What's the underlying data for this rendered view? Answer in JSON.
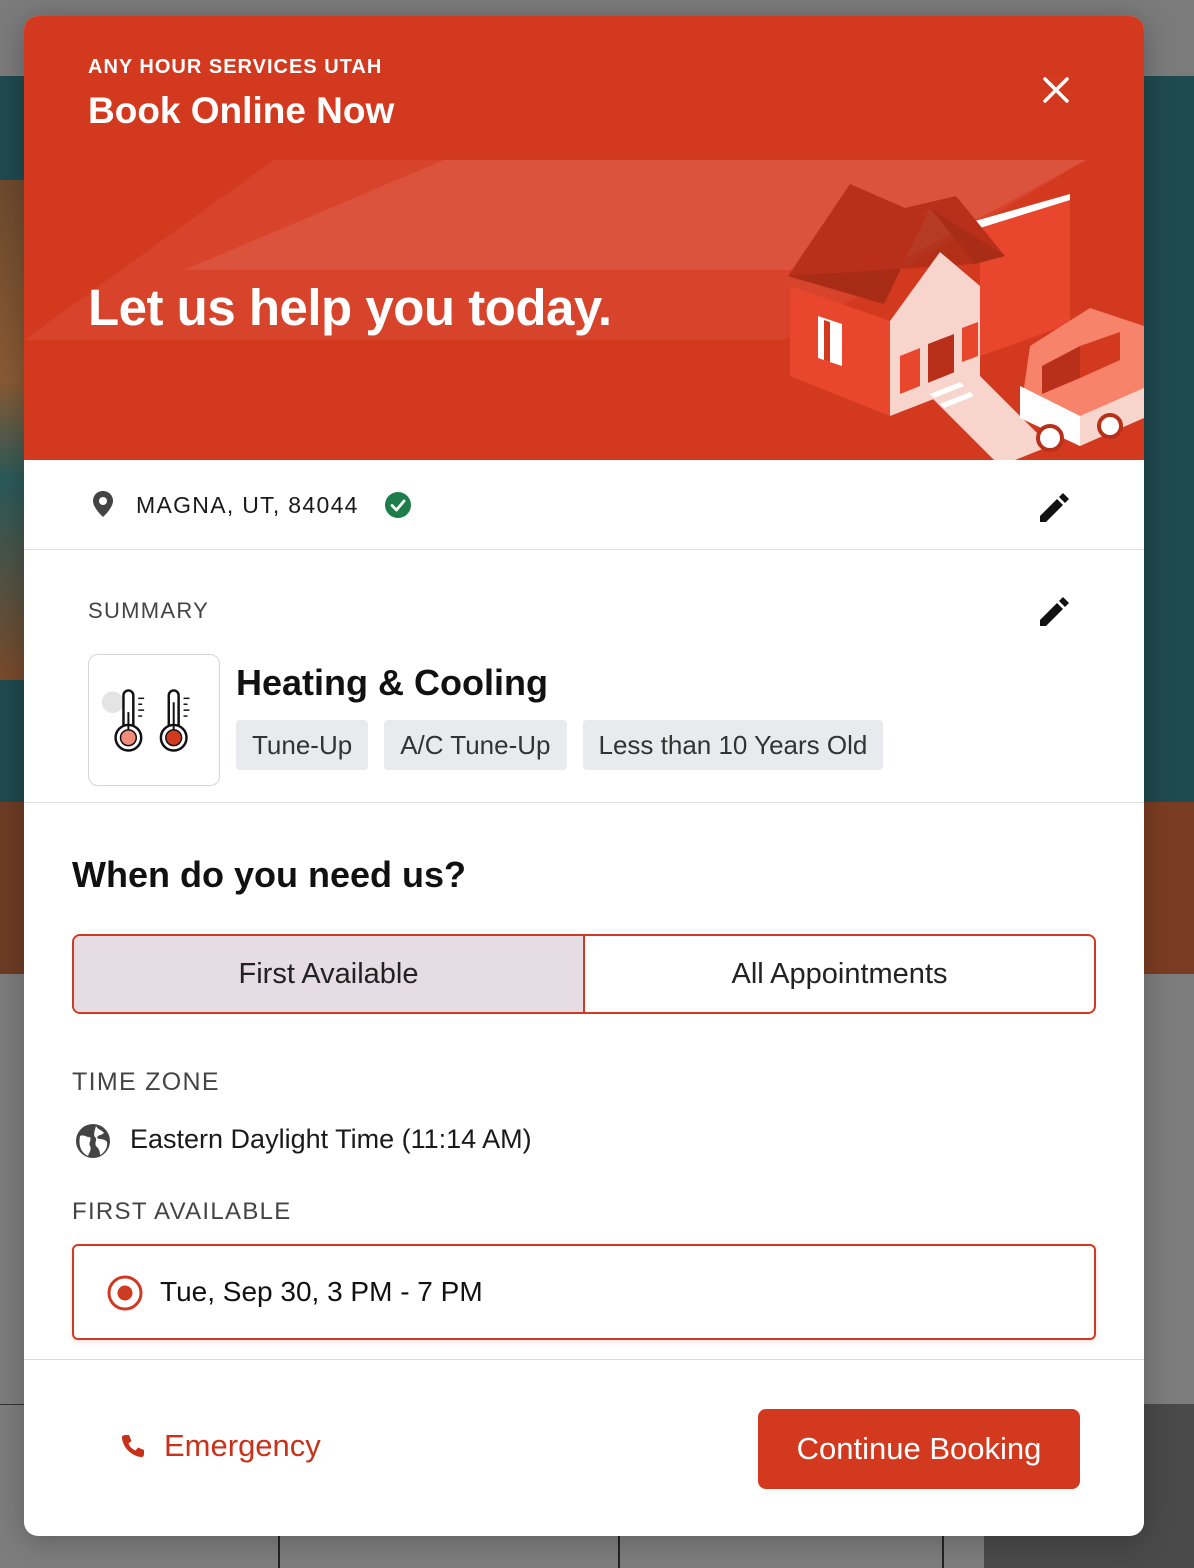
{
  "modal": {
    "brand": "ANY HOUR SERVICES UTAH",
    "title": "Book Online Now",
    "tagline": "Let us help you today.",
    "close_icon": "close-icon"
  },
  "location": {
    "text": "MAGNA, UT, 84044",
    "pin_icon": "location-pin-icon",
    "verified_icon": "check-circle-icon",
    "edit_icon": "pencil-icon"
  },
  "summary": {
    "label": "SUMMARY",
    "service": "Heating & Cooling",
    "service_icon": "thermometer-icon",
    "chips": [
      "Tune-Up",
      "A/C Tune-Up",
      "Less than 10 Years Old"
    ],
    "edit_icon": "pencil-icon"
  },
  "schedule": {
    "title": "When do you need us?",
    "tabs": [
      {
        "label": "First Available",
        "active": true
      },
      {
        "label": "All Appointments",
        "active": false
      }
    ],
    "timezone_label": "TIME ZONE",
    "timezone_value": "Eastern Daylight Time (11:14 AM)",
    "timezone_icon": "globe-icon",
    "first_available_label": "FIRST AVAILABLE",
    "slot": {
      "text": "Tue, Sep 30, 3 PM - 7 PM",
      "selected": true
    }
  },
  "footer": {
    "emergency_label": "Emergency",
    "emergency_icon": "phone-icon",
    "continue_label": "Continue Booking"
  },
  "colors": {
    "brand_red": "#d3391e",
    "tab_active_bg": "#e6dce4",
    "chip_bg": "#e8eaed",
    "verified_green": "#1e7e4a"
  }
}
